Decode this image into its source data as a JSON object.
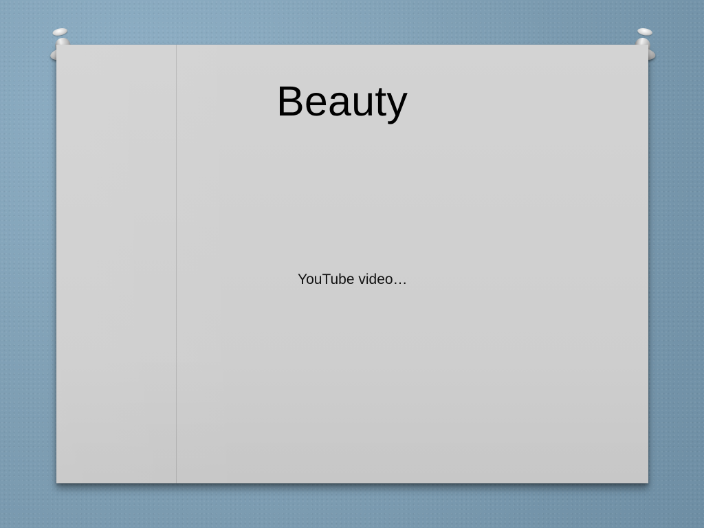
{
  "slide": {
    "title": "Beauty",
    "body": "YouTube video…"
  },
  "icons": {
    "pin_left": "pushpin-icon",
    "pin_right": "pushpin-icon"
  },
  "colors": {
    "background": "#7f9fb4",
    "paper": "#cfcfcf",
    "text": "#000000"
  }
}
